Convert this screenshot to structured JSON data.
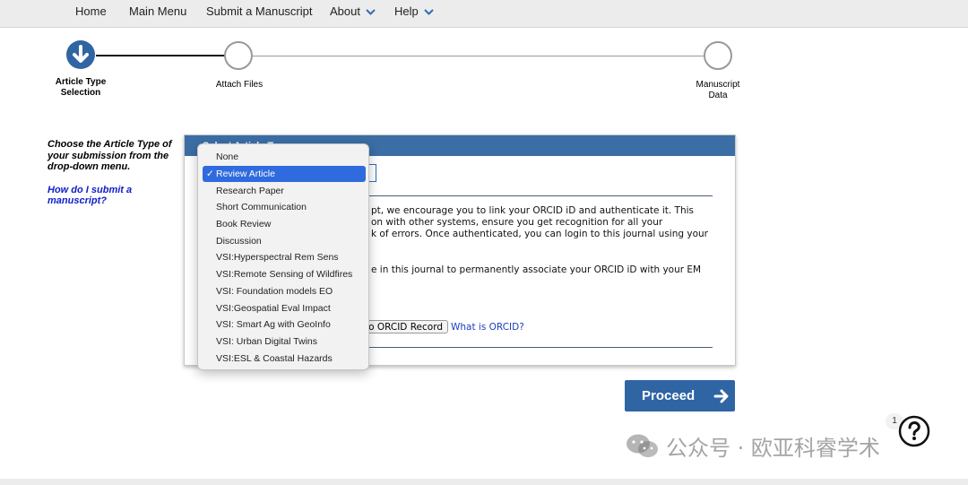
{
  "nav": {
    "items": [
      "Home",
      "Main Menu",
      "Submit a Manuscript",
      "About",
      "Help"
    ]
  },
  "steps": [
    {
      "label": "Article Type Selection",
      "state": "current"
    },
    {
      "label": "Attach Files",
      "state": "pending"
    },
    {
      "label": "Manuscript Data",
      "state": "pending"
    }
  ],
  "sidebar": {
    "instruction": "Choose the Article Type of your submission from the drop-down menu.",
    "help_link": "How do I submit a manuscript?"
  },
  "panel": {
    "header": "Select Article Type",
    "orcid_text_lines": [
      "pt, we encourage you to link your ORCID iD and authenticate it. This",
      "on with other systems, ensure you get recognition for all your",
      "k of errors. Once authenticated, you can login to this journal using your"
    ],
    "orcid_text_line4": "e in this journal to permanently associate your ORCID iD with your EM",
    "orcid_button": "o ORCID Record",
    "orcid_link": "What is ORCID?"
  },
  "dropdown": {
    "options": [
      "None",
      "Review Article",
      "Research Paper",
      "Short Communication",
      "Book Review",
      "Discussion",
      "VSI:Hyperspectral Rem Sens",
      "VSI:Remote Sensing of Wildfires",
      "VSI: Foundation models EO",
      "VSI:Geospatial Eval Impact",
      "VSI: Smart Ag with GeoInfo",
      "VSI: Urban Digital Twins",
      "VSI:ESL & Coastal Hazards"
    ],
    "selected": "Review Article",
    "check": "✓"
  },
  "proceed_label": "Proceed",
  "help": {
    "badge": "1",
    "icon": "question-icon"
  },
  "watermark": "公众号 · 欧亚科睿学术",
  "colors": {
    "accent": "#2f65a3",
    "header": "#3a6ea5",
    "selected": "#2f6bde",
    "link": "#1020c8"
  }
}
